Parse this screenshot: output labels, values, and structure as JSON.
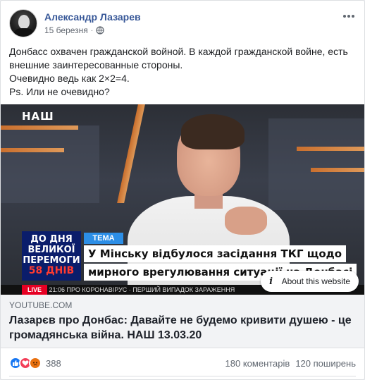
{
  "post": {
    "author": "Александр Лазарев",
    "date": "15 березня",
    "dot": "·",
    "text_lines": [
      "Донбасс охвачен гражданской войной. В каждой гражданской войне, есть внешние заинтересованные стороны.",
      "Очевидно ведь как 2×2=4.",
      "Ps. Или не очевидно?"
    ]
  },
  "video": {
    "channel": "НАШ",
    "badge_line1": "ДО ДНЯ",
    "badge_line2": "ВЕЛИКОЇ",
    "badge_line3": "ПЕРЕМОГИ",
    "badge_days": "58 ДНІВ",
    "tag": "ТЕМА",
    "headline_1": "У Мінську відбулося засідання ТКГ щодо",
    "headline_2": "мирного врегулювання ситуації на Донбасі",
    "ticker_live": "LIVE",
    "ticker_text": "21:06  ПРО КОРОНАВІРУС  ·  ПЕРШИЙ ВИПАДОК ЗАРАЖЕННЯ",
    "about_label": "About this website"
  },
  "link": {
    "domain": "YOUTUBE.COM",
    "title": "Лазарєв про Донбас: Давайте не будемо кривити душею - це громадянська війна. НАШ 13.03.20"
  },
  "stats": {
    "reactions_count": "388",
    "comments": "180 коментарів",
    "shares": "120 поширень"
  },
  "icons": {
    "globe": "globe-icon",
    "more": "more-icon",
    "info": "info-icon",
    "like": "like-icon",
    "love": "love-icon",
    "angry": "angry-icon"
  },
  "colors": {
    "author_link": "#385898",
    "like": "#1877f2",
    "love": "#f33e58",
    "angry": "#e9710f",
    "tag_blue": "#2c8ee6",
    "badge_navy": "#0a1d6b",
    "live_red": "#e60023"
  }
}
